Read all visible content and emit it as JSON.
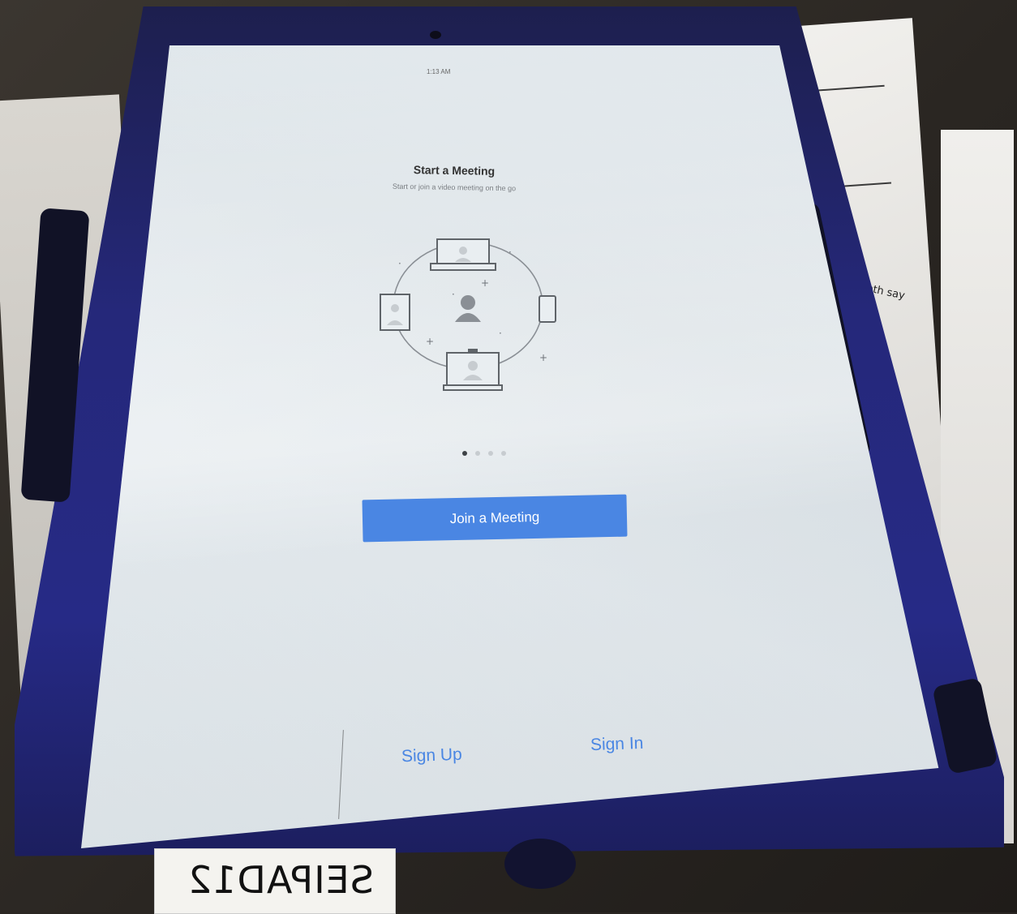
{
  "status_bar": {
    "time": "1:13 AM"
  },
  "onboarding": {
    "title": "Start a Meeting",
    "subtitle": "Start or join a video meeting on the go",
    "page_indicator": {
      "total": 4,
      "active_index": 0
    }
  },
  "buttons": {
    "join": "Join a Meeting",
    "sign_up": "Sign Up",
    "sign_in": "Sign In"
  },
  "surroundings": {
    "paper_note": "both say",
    "asset_label": "SEIPAD12"
  },
  "icons": [
    "laptop-icon",
    "tablet-icon",
    "phone-icon",
    "person-icon",
    "room-display-icon"
  ],
  "colors": {
    "accent": "#4a86e3",
    "case": "#262a86",
    "screen_bg": "#e4eaee",
    "title_text": "#333333"
  }
}
